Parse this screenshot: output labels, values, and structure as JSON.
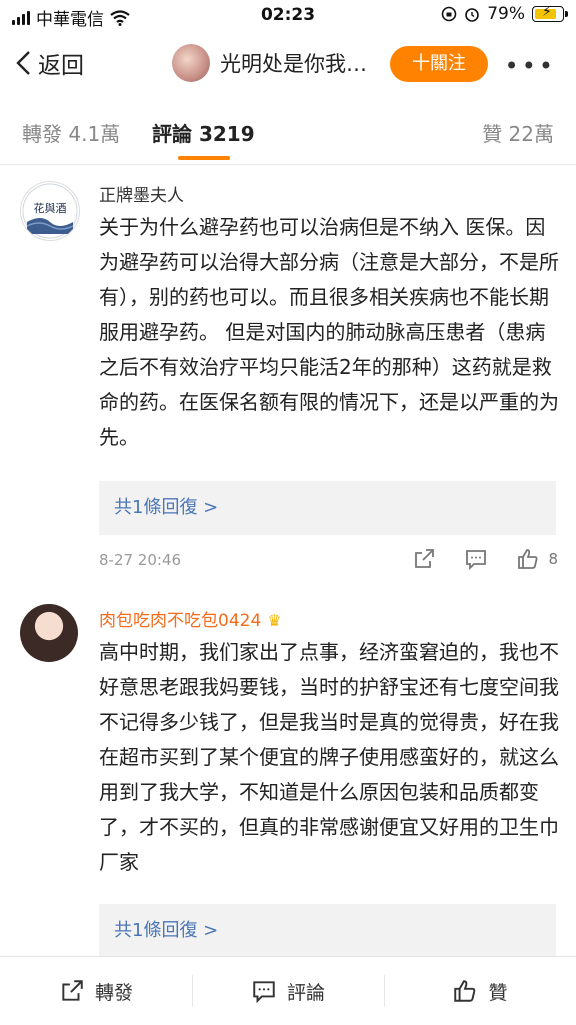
{
  "status": {
    "carrier": "中華電信",
    "time": "02:23",
    "battery": "79%",
    "battery_level": 0.79
  },
  "nav": {
    "back_label": "返回",
    "title": "光明处是你我…",
    "follow_label": "十關注",
    "more_label": "•••"
  },
  "tabs": {
    "repost": "轉發 4.1萬",
    "comments": "評論 3219",
    "likes": "贊 22萬"
  },
  "comments": [
    {
      "author": "正牌墨夫人",
      "avatar_text": "花與酒",
      "text": "关于为什么避孕药也可以治病但是不纳入 医保。因为避孕药可以治得大部分病（注意是大部分，不是所有），别的药也可以。而且很多相关疾病也不能长期服用避孕药。 但是对国内的肺动脉高压患者（患病之后不有效治疗平均只能活2年的那种）这药就是救命的药。在医保名额有限的情况下，还是以严重的为先。",
      "replies": "共1條回復 >",
      "time": "8-27 20:46",
      "likes": "8"
    },
    {
      "author": "肉包吃肉不吃包0424",
      "text": "高中时期，我们家出了点事，经济蛮窘迫的，我也不好意思老跟我妈要钱，当时的护舒宝还有七度空间我不记得多少钱了，但是我当时是真的觉得贵，好在我在超市买到了某个便宜的牌子使用感蛮好的，就这么用到了我大学，不知道是什么原因包装和品质都变了，才不买的，但真的非常感谢便宜又好用的卫生巾厂家",
      "replies": "共1條回復 >"
    }
  ],
  "bottom": {
    "repost": "轉發",
    "comment": "評論",
    "like": "贊"
  },
  "colors": {
    "accent": "#ff8200",
    "link": "#4a76b5",
    "vip_name": "#f36b1b"
  }
}
